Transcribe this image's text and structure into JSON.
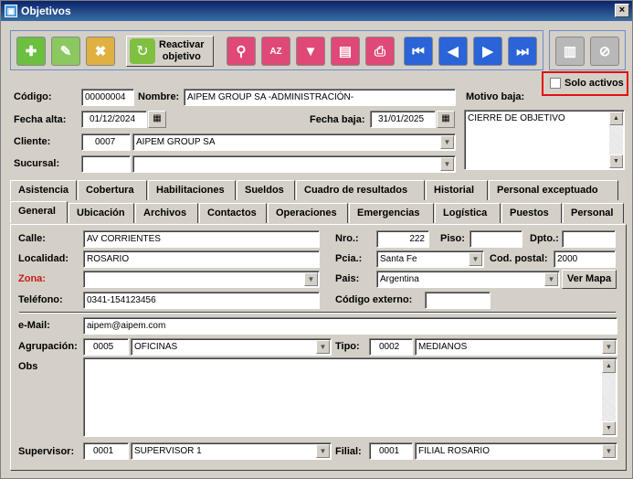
{
  "window": {
    "title": "Objetivos",
    "close": "×"
  },
  "toolbar": {
    "reactivar_line1": "Reactivar",
    "reactivar_line2": "objetivo",
    "sort_glyph": "AZ"
  },
  "solo_activos": {
    "label": "Solo activos",
    "checked": false
  },
  "header": {
    "codigo_label": "Código:",
    "codigo": "00000004",
    "nombre_label": "Nombre:",
    "nombre": "AIPEM GROUP SA -ADMINISTRACIÓN-",
    "motivo_baja_label": "Motivo baja:",
    "motivo_baja": "CIERRE DE OBJETIVO",
    "fecha_alta_label": "Fecha alta:",
    "fecha_alta": "01/12/2024",
    "fecha_baja_label": "Fecha baja:",
    "fecha_baja": "31/01/2025",
    "cliente_label": "Cliente:",
    "cliente_code": "0007",
    "cliente_name": "AIPEM GROUP SA",
    "sucursal_label": "Sucursal:",
    "sucursal_code": "",
    "sucursal_name": ""
  },
  "tabs_row1": [
    "Asistencia",
    "Cobertura",
    "Habilitaciones",
    "Sueldos",
    "Cuadro de resultados",
    "Historial",
    "Personal exceptuado"
  ],
  "tabs_row2": [
    "General",
    "Ubicación",
    "Archivos",
    "Contactos",
    "Operaciones",
    "Emergencias",
    "Logística",
    "Puestos",
    "Personal"
  ],
  "general": {
    "calle_label": "Calle:",
    "calle": "AV CORRIENTES",
    "nro_label": "Nro.:",
    "nro": "222",
    "piso_label": "Piso:",
    "piso": "",
    "dpto_label": "Dpto.:",
    "dpto": "",
    "localidad_label": "Localidad:",
    "localidad": "ROSARIO",
    "pcia_label": "Pcia.:",
    "pcia": "Santa Fe",
    "cp_label": "Cod. postal:",
    "cp": "2000",
    "zona_label": "Zona:",
    "zona": "",
    "pais_label": "Pais:",
    "pais": "Argentina",
    "ver_mapa": "Ver Mapa",
    "telefono_label": "Teléfono:",
    "telefono": "0341-154123456",
    "cod_externo_label": "Código externo:",
    "cod_externo": "",
    "email_label": "e-Mail:",
    "email": "aipem@aipem.com",
    "agrupacion_label": "Agrupación:",
    "agrupacion_code": "0005",
    "agrupacion_name": "OFICINAS",
    "tipo_label": "Tipo:",
    "tipo_code": "0002",
    "tipo_name": "MEDIANOS",
    "obs_label": "Obs",
    "obs": "",
    "supervisor_label": "Supervisor:",
    "supervisor_code": "0001",
    "supervisor_name": "SUPERVISOR 1",
    "filial_label": "Filial:",
    "filial_code": "0001",
    "filial_name": "FILIAL ROSARIO"
  }
}
